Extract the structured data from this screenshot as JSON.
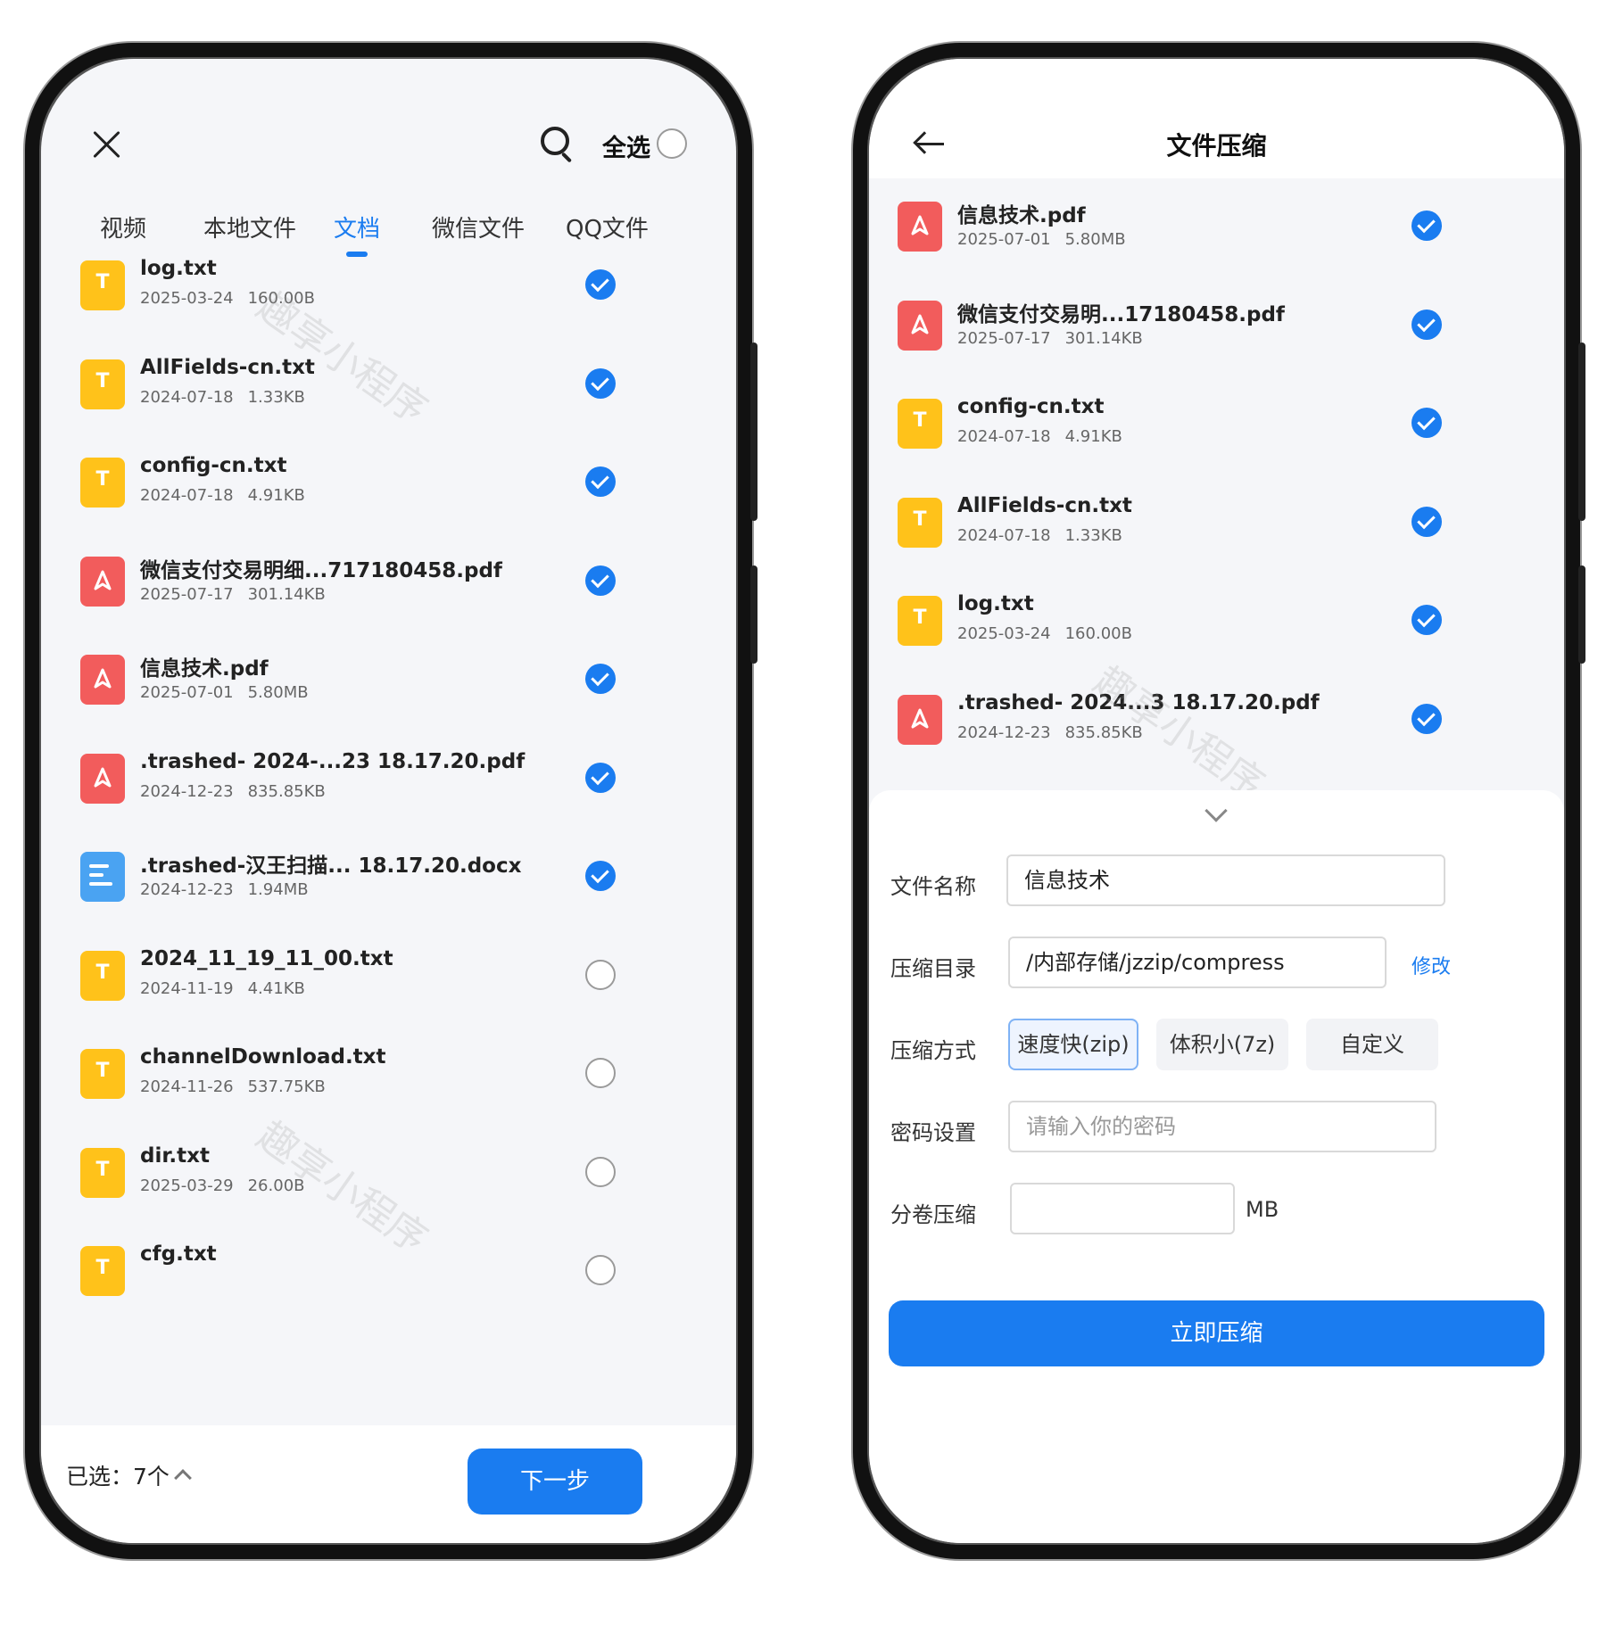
{
  "left": {
    "select_all": "全选",
    "tabs": [
      {
        "label": "视频",
        "active": false
      },
      {
        "label": "本地文件",
        "active": false
      },
      {
        "label": "文档",
        "active": true
      },
      {
        "label": "微信文件",
        "active": false
      },
      {
        "label": "QQ文件",
        "active": false
      }
    ],
    "files": [
      {
        "name": "log.txt",
        "date": "2025-03-24",
        "size": "160.00B",
        "type": "txt",
        "checked": true
      },
      {
        "name": "AllFields-cn.txt",
        "date": "2024-07-18",
        "size": "1.33KB",
        "type": "txt",
        "checked": true
      },
      {
        "name": "config-cn.txt",
        "date": "2024-07-18",
        "size": "4.91KB",
        "type": "txt",
        "checked": true
      },
      {
        "name": "微信支付交易明细...717180458.pdf",
        "date": "2025-07-17",
        "size": "301.14KB",
        "type": "pdf",
        "checked": true
      },
      {
        "name": "信息技术.pdf",
        "date": "2025-07-01",
        "size": "5.80MB",
        "type": "pdf",
        "checked": true
      },
      {
        "name": ".trashed- 2024-...23 18.17.20.pdf",
        "date": "2024-12-23",
        "size": "835.85KB",
        "type": "pdf",
        "checked": true
      },
      {
        "name": ".trashed-汉王扫描... 18.17.20.docx",
        "date": "2024-12-23",
        "size": "1.94MB",
        "type": "doc",
        "checked": true
      },
      {
        "name": "2024_11_19_11_00.txt",
        "date": "2024-11-19",
        "size": "4.41KB",
        "type": "txt",
        "checked": false
      },
      {
        "name": "channelDownload.txt",
        "date": "2024-11-26",
        "size": "537.75KB",
        "type": "txt",
        "checked": false
      },
      {
        "name": "dir.txt",
        "date": "2025-03-29",
        "size": "26.00B",
        "type": "txt",
        "checked": false
      },
      {
        "name": "cfg.txt",
        "date": "",
        "size": "",
        "type": "txt",
        "checked": false
      }
    ],
    "selected_count": "已选：7个",
    "next_label": "下一步",
    "watermark": "趣享小程序"
  },
  "right": {
    "title": "文件压缩",
    "files": [
      {
        "name": "信息技术.pdf",
        "date": "2025-07-01",
        "size": "5.80MB",
        "type": "pdf"
      },
      {
        "name": "微信支付交易明...17180458.pdf",
        "date": "2025-07-17",
        "size": "301.14KB",
        "type": "pdf"
      },
      {
        "name": "config-cn.txt",
        "date": "2024-07-18",
        "size": "4.91KB",
        "type": "txt"
      },
      {
        "name": "AllFields-cn.txt",
        "date": "2024-07-18",
        "size": "1.33KB",
        "type": "txt"
      },
      {
        "name": "log.txt",
        "date": "2025-03-24",
        "size": "160.00B",
        "type": "txt"
      },
      {
        "name": ".trashed- 2024...3 18.17.20.pdf",
        "date": "2024-12-23",
        "size": "835.85KB",
        "type": "pdf"
      }
    ],
    "form": {
      "filename_label": "文件名称",
      "filename_value": "信息技术",
      "dir_label": "压缩目录",
      "dir_value": "/内部存储/jzzip/compress",
      "modify_label": "修改",
      "mode_label": "压缩方式",
      "modes": [
        "速度快(zip)",
        "体积小(7z)",
        "自定义"
      ],
      "password_label": "密码设置",
      "password_placeholder": "请输入你的密码",
      "split_label": "分卷压缩",
      "split_value": "",
      "split_unit": "MB",
      "submit_label": "立即压缩"
    },
    "watermark": "趣享小程序"
  },
  "colors": {
    "accent": "#1a7cf0",
    "txt_icon": "#ffc21a",
    "pdf_icon": "#f25c5c",
    "doc_icon": "#4aa3f2"
  }
}
